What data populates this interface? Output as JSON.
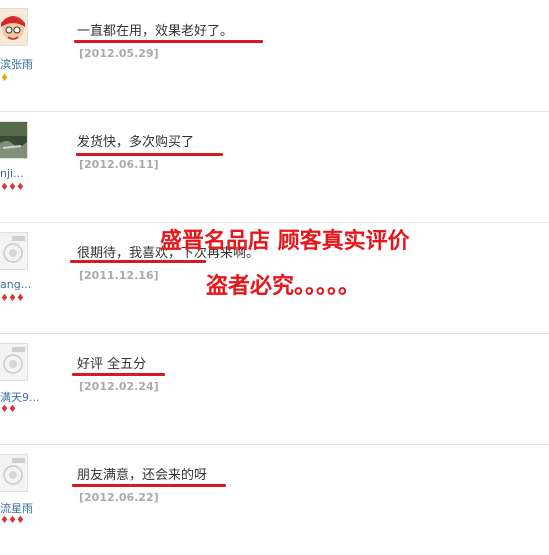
{
  "reviews": [
    {
      "user": "滨张雨",
      "comment": "一直都在用，效果老好了。",
      "date": "[2012.05.29]",
      "badge": "♦",
      "badge_color": "gold"
    },
    {
      "user": "nji...",
      "comment": "发货快，多次购买了",
      "date": "[2012.06.11]",
      "badge": "♦♦♦",
      "badge_color": "red"
    },
    {
      "user": "ang...",
      "comment": "很期待，我喜欢，下次再来啊。",
      "date": "[2011.12.16]",
      "badge": "♦♦♦",
      "badge_color": "red"
    },
    {
      "user": "满天9...",
      "comment": "好评 全五分",
      "date": "[2012.02.24]",
      "badge": "♦♦",
      "badge_color": "red"
    },
    {
      "user": "流星雨",
      "comment": "朋友满意，还会来的呀",
      "date": "[2012.06.22]",
      "badge": "♦♦♦",
      "badge_color": "red"
    }
  ],
  "watermark": {
    "line1": "盛晋名品店 顾客真实评价",
    "line2": "盗者必究。。。。。",
    "color": "#e8151b"
  },
  "underline_color": "#d71a21"
}
